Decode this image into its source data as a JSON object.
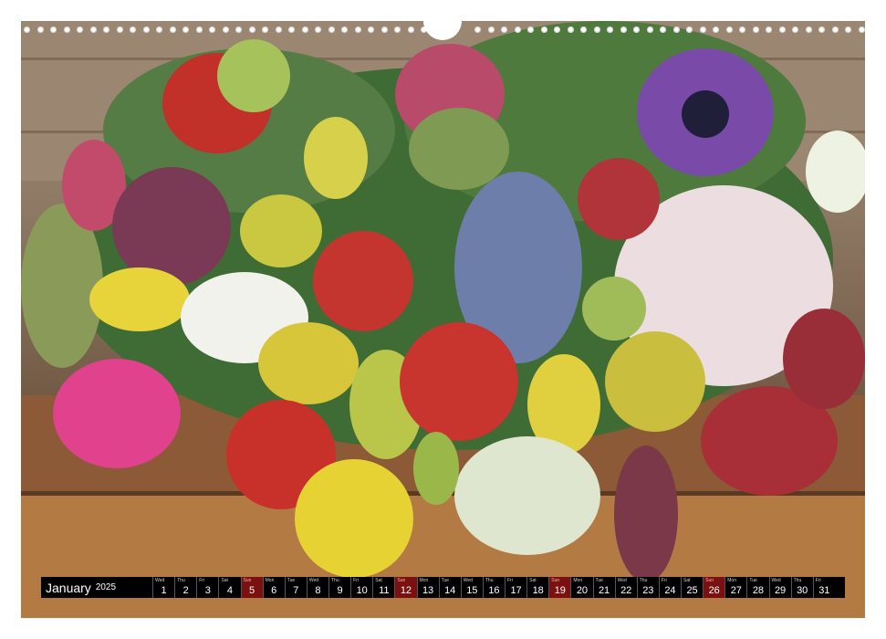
{
  "calendar": {
    "month": "January",
    "year": "2025",
    "days": [
      {
        "dn": "Wed",
        "d": "1",
        "sun": false
      },
      {
        "dn": "Thu",
        "d": "2",
        "sun": false
      },
      {
        "dn": "Fri",
        "d": "3",
        "sun": false
      },
      {
        "dn": "Sat",
        "d": "4",
        "sun": false
      },
      {
        "dn": "Sun",
        "d": "5",
        "sun": true
      },
      {
        "dn": "Mon",
        "d": "6",
        "sun": false
      },
      {
        "dn": "Tue",
        "d": "7",
        "sun": false
      },
      {
        "dn": "Wed",
        "d": "8",
        "sun": false
      },
      {
        "dn": "Thu",
        "d": "9",
        "sun": false
      },
      {
        "dn": "Fri",
        "d": "10",
        "sun": false
      },
      {
        "dn": "Sat",
        "d": "11",
        "sun": false
      },
      {
        "dn": "Sun",
        "d": "12",
        "sun": true
      },
      {
        "dn": "Mon",
        "d": "13",
        "sun": false
      },
      {
        "dn": "Tue",
        "d": "14",
        "sun": false
      },
      {
        "dn": "Wed",
        "d": "15",
        "sun": false
      },
      {
        "dn": "Thu",
        "d": "16",
        "sun": false
      },
      {
        "dn": "Fri",
        "d": "17",
        "sun": false
      },
      {
        "dn": "Sat",
        "d": "18",
        "sun": false
      },
      {
        "dn": "Sun",
        "d": "19",
        "sun": true
      },
      {
        "dn": "Mon",
        "d": "20",
        "sun": false
      },
      {
        "dn": "Tue",
        "d": "21",
        "sun": false
      },
      {
        "dn": "Wed",
        "d": "22",
        "sun": false
      },
      {
        "dn": "Thu",
        "d": "23",
        "sun": false
      },
      {
        "dn": "Fri",
        "d": "24",
        "sun": false
      },
      {
        "dn": "Sat",
        "d": "25",
        "sun": false
      },
      {
        "dn": "Sun",
        "d": "26",
        "sun": true
      },
      {
        "dn": "Mon",
        "d": "27",
        "sun": false
      },
      {
        "dn": "Tue",
        "d": "28",
        "sun": false
      },
      {
        "dn": "Wed",
        "d": "29",
        "sun": false
      },
      {
        "dn": "Thu",
        "d": "30",
        "sun": false
      },
      {
        "dn": "Fri",
        "d": "31",
        "sun": false
      }
    ]
  },
  "colors": {
    "sunday": "#7a1010",
    "bar": "#000000"
  }
}
